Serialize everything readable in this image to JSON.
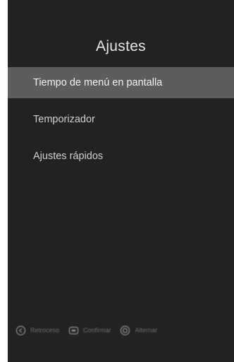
{
  "title": "Ajustes",
  "menu": {
    "items": [
      {
        "label": "Tiempo de menú en pantalla",
        "selected": true
      },
      {
        "label": "Temporizador",
        "selected": false
      },
      {
        "label": "Ajustes rápidos",
        "selected": false
      }
    ]
  },
  "hints": [
    {
      "icon": "back-circle-icon",
      "label": "Retroceso"
    },
    {
      "icon": "menu-button-icon",
      "label": "Confirmar"
    },
    {
      "icon": "directional-pad-icon",
      "label": "Alternar"
    }
  ],
  "colors": {
    "panel_background": "#222222",
    "selected_row": "#5d5d5d",
    "text": "#d0d0d0",
    "hint_text": "#6e6e6e"
  }
}
